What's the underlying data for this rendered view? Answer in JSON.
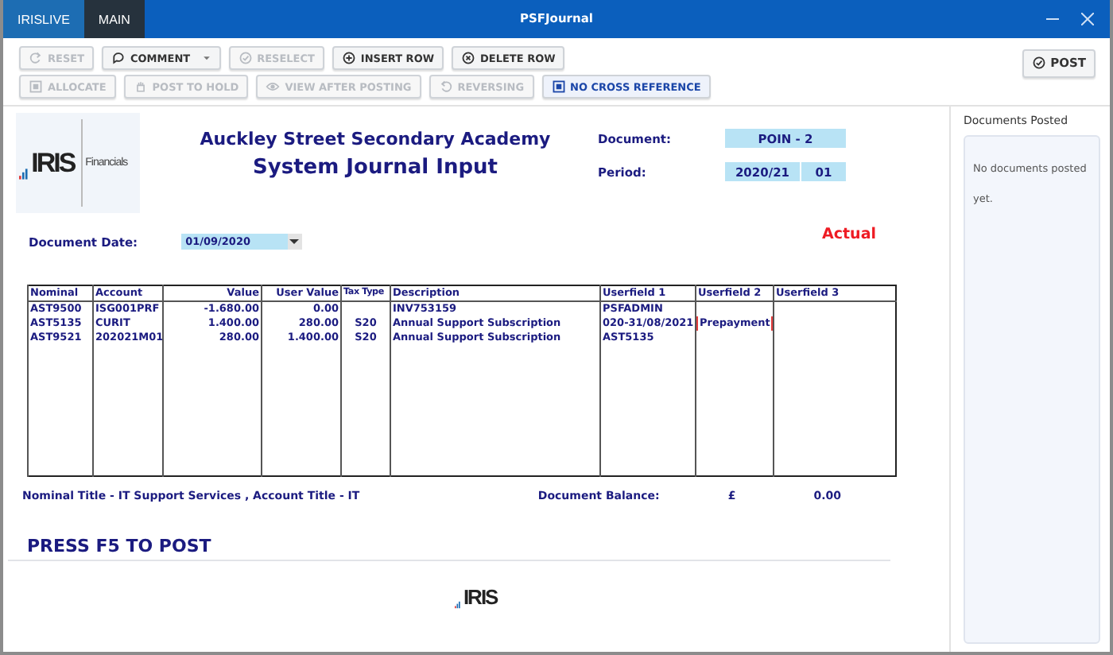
{
  "window": {
    "title": "PSFJournal",
    "tabs": [
      {
        "label": "IRISLIVE",
        "selected": false
      },
      {
        "label": "MAIN",
        "selected": true
      }
    ]
  },
  "toolbar": {
    "primary_actions": [
      {
        "label": "RESET",
        "disabled": true
      },
      {
        "label": "COMMENT",
        "disabled": false,
        "dropdown": true
      },
      {
        "label": "RESELECT",
        "disabled": true
      },
      {
        "label": "INSERT ROW",
        "disabled": false
      },
      {
        "label": "DELETE ROW",
        "disabled": false
      }
    ],
    "secondary_actions": [
      {
        "label": "ALLOCATE",
        "disabled": true
      },
      {
        "label": "POST TO HOLD",
        "disabled": true
      },
      {
        "label": "VIEW AFTER POSTING",
        "disabled": true
      },
      {
        "label": "REVERSING",
        "disabled": true
      },
      {
        "label": "NO CROSS REFERENCE",
        "disabled": false,
        "highlighted": true
      }
    ],
    "post": {
      "label": "POST",
      "disabled": false
    }
  },
  "header": {
    "school": "Auckley Street Secondary Academy",
    "title": "System Journal Input",
    "logo_text": "IRIS",
    "logo_side_text": "Financials",
    "document_label": "Document:",
    "document": "POIN - 2",
    "period_label": "Period:",
    "period_year": "2020/21",
    "period_number": "01",
    "document_date_label": "Document Date:",
    "document_date": "01/09/2020",
    "status": "Actual"
  },
  "table": {
    "columns": [
      "Nominal",
      "Account",
      "Value",
      "User Value",
      "Tax Type",
      "Description",
      "Userfield 1",
      "Userfield 2",
      "Userfield 3"
    ],
    "rows": [
      {
        "nominal": "AST9500",
        "account": "ISG001PRF",
        "value": "-1.680.00",
        "user_value": "0.00",
        "description": "INV753159",
        "userfield_1": "PSFADMIN",
        "selected": false
      },
      {
        "nominal": "AST5135",
        "account": "CURIT",
        "value": "1.400.00",
        "user_value": "280.00",
        "tax_type": "S20",
        "description": "Annual Support Subscription",
        "userfield_1": "020-31/08/2021",
        "userfield_2": "Prepayment",
        "selected": true
      },
      {
        "nominal": "AST9521",
        "account": "202021M01",
        "value": "280.00",
        "user_value": "1.400.00",
        "tax_type": "S20",
        "description": "Annual Support Subscription",
        "userfield_1": "AST5135",
        "selected": false
      }
    ]
  },
  "footer": {
    "nominal_title": "Nominal Title - IT Support Services , Account Title - IT",
    "balance_label": "Document Balance:",
    "currency": "£",
    "balance": "0.00",
    "press_hint": "PRESS F5 TO POST",
    "logo_text": "IRIS"
  },
  "sidebar": {
    "title": "Documents Posted",
    "message": "No documents posted yet."
  }
}
